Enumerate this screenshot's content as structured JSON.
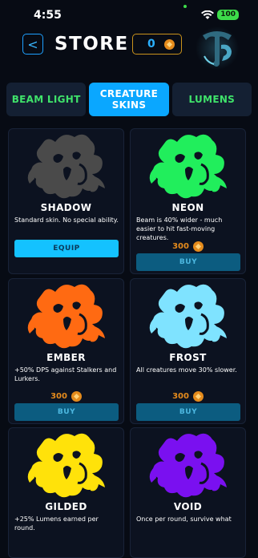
{
  "status_bar": {
    "time": "4:55",
    "battery": "100"
  },
  "header": {
    "back_icon": "<",
    "title": "STORE",
    "currency": "0"
  },
  "tabs": [
    {
      "label": "BEAM LIGHT",
      "active": false
    },
    {
      "label": "CREATURE SKINS",
      "active": true
    },
    {
      "label": "LUMENS",
      "active": false
    }
  ],
  "skins": [
    {
      "name": "SHADOW",
      "desc": "Standard skin. No special ability.",
      "color": "#4a4a4a",
      "action": "EQUIP"
    },
    {
      "name": "NEON",
      "desc": "Beam is 40% wider - much easier to hit fast-moving creatures.",
      "color": "#21ee5c",
      "price": "300",
      "action": "BUY"
    },
    {
      "name": "EMBER",
      "desc": "+50% DPS against Stalkers and Lurkers.",
      "color": "#ff6a12",
      "price": "300",
      "action": "BUY"
    },
    {
      "name": "FROST",
      "desc": "All creatures move 30% slower.",
      "color": "#7fe3ff",
      "price": "300",
      "action": "BUY"
    },
    {
      "name": "GILDED",
      "desc": "+25% Lumens earned per round.",
      "color": "#ffe20a"
    },
    {
      "name": "VOID",
      "desc": "Once per round, survive what",
      "color": "#7a10f0"
    }
  ]
}
